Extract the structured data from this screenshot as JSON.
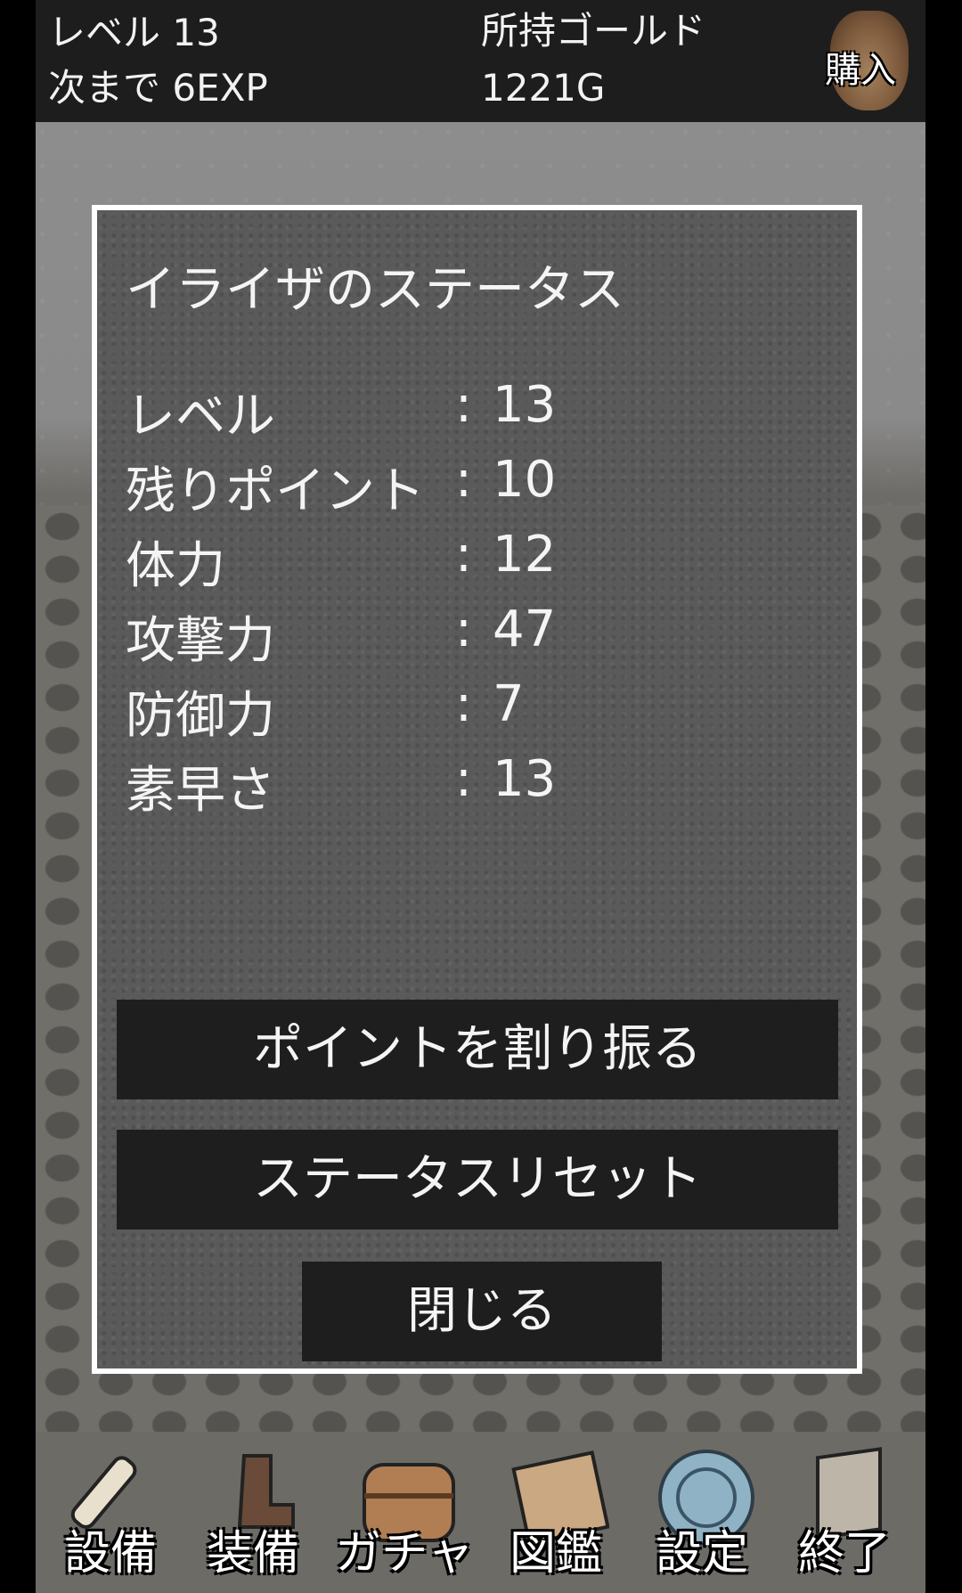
{
  "hud": {
    "level_text": "レベル 13",
    "next_exp_text": "次まで 6EXP",
    "gold_label": "所持ゴールド",
    "gold_value": "1221G",
    "buy_label": "購入"
  },
  "dialog": {
    "title": "イライザのステータス",
    "colon": ":",
    "stats": [
      {
        "label": "レベル",
        "value": "13"
      },
      {
        "label": "残りポイント",
        "value": "10"
      },
      {
        "label": "体力",
        "value": "12"
      },
      {
        "label": "攻撃力",
        "value": "47"
      },
      {
        "label": "防御力",
        "value": "7"
      },
      {
        "label": "素早さ",
        "value": "13"
      }
    ],
    "allocate_label": "ポイントを割り振る",
    "reset_label": "ステータスリセット",
    "close_label": "閉じる"
  },
  "nav": [
    {
      "label": "設備",
      "icon": "scroll-icon"
    },
    {
      "label": "装備",
      "icon": "boots-icon"
    },
    {
      "label": "ガチャ",
      "icon": "chest-icon"
    },
    {
      "label": "図鑑",
      "icon": "book-icon"
    },
    {
      "label": "設定",
      "icon": "gear-orb-icon"
    },
    {
      "label": "終了",
      "icon": "door-icon"
    }
  ]
}
